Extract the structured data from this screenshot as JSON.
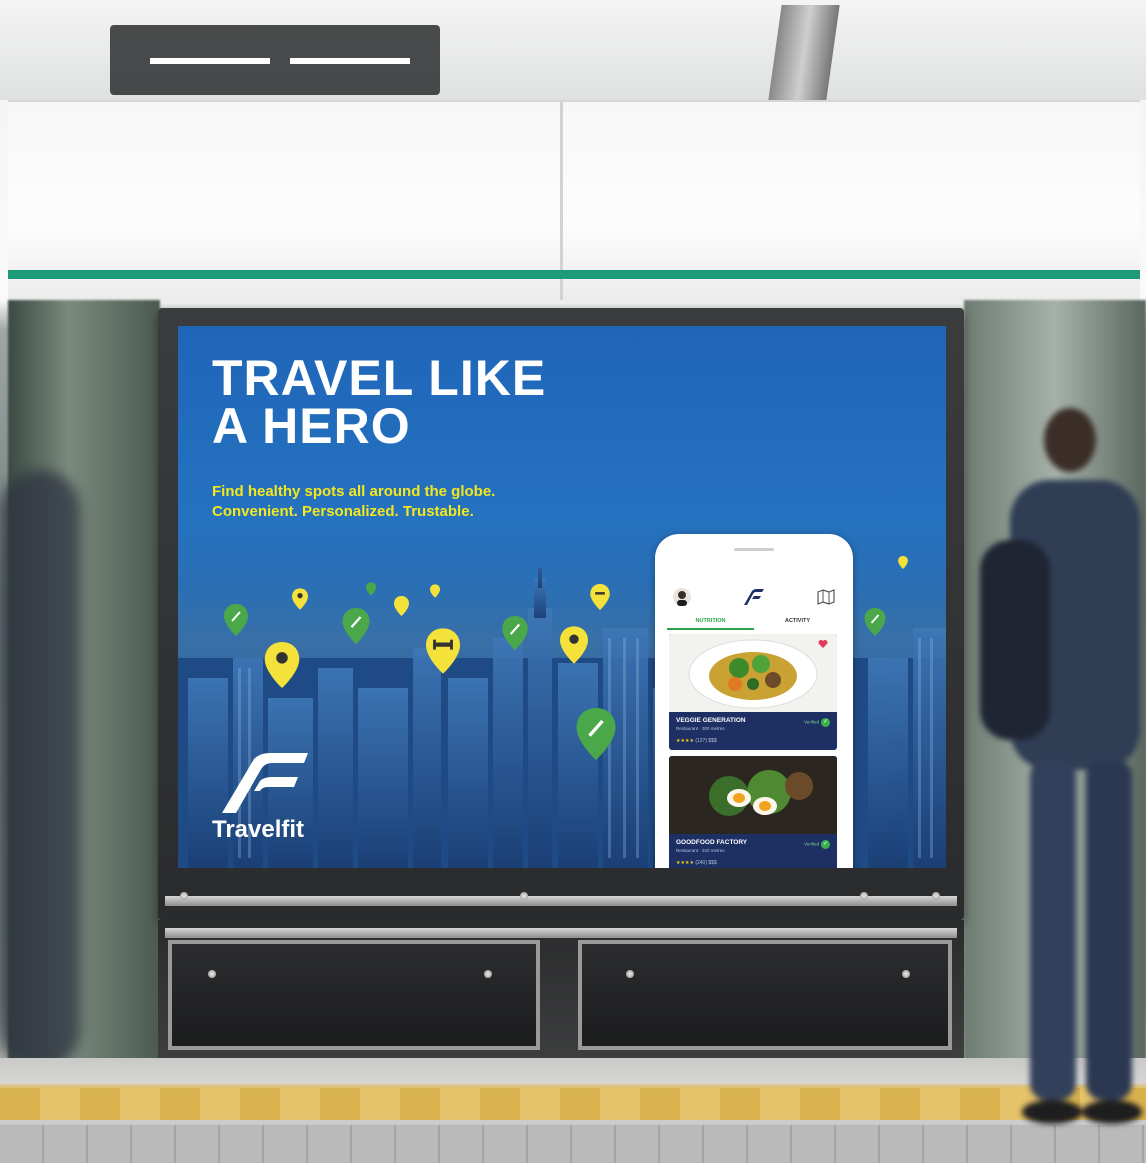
{
  "scene": {
    "description_colors": {
      "poster_blue": "#2572c0",
      "stripe_green": "#1d9a78",
      "tagline_yellow": "#f4e81c",
      "pin_green": "#4aa84a",
      "pin_yellow": "#f4e13a"
    }
  },
  "poster": {
    "headline_line1": "TRAVEL LIKE",
    "headline_line2": "A HERO",
    "tagline_line1": "Find healthy spots all around the globe.",
    "tagline_line2": "Convenient. Personalized. Trustable.",
    "brand_name": "Travelfit"
  },
  "app": {
    "tabs": [
      {
        "label": "NUTRITION",
        "active": true
      },
      {
        "label": "ACTIVITY",
        "active": false
      }
    ],
    "cards": [
      {
        "title": "VEGGIE GENERATION",
        "subtitle": "Restaurant · 300 metres",
        "stars": "★★★★",
        "rating_rest": "(127)  $$$",
        "verified": "Verified"
      },
      {
        "title": "GOODFOOD FACTORY",
        "subtitle": "Restaurant · 320 metres",
        "stars": "★★★★",
        "rating_rest": "(240)  $$$",
        "verified": "Verified"
      }
    ]
  }
}
